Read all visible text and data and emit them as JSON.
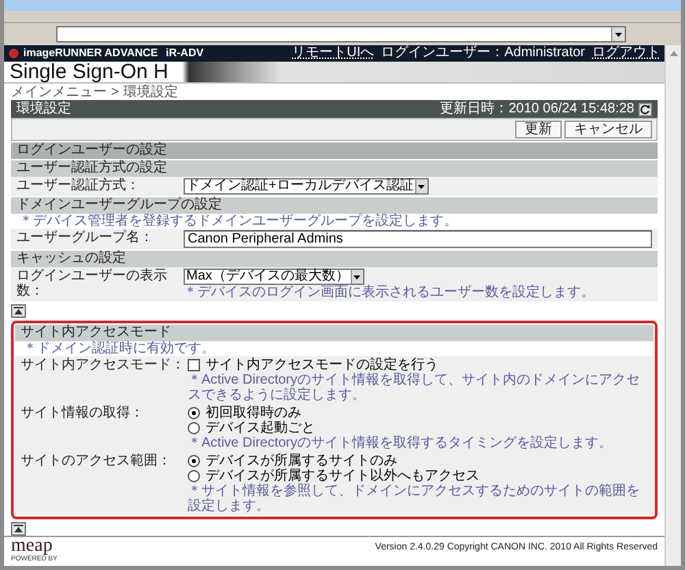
{
  "header": {
    "brand": "imageRUNNER ADVANCE",
    "device": "iR-ADV",
    "links": [
      {
        "kind": "link",
        "text": "リモートUIへ"
      },
      {
        "kind": "user",
        "text": "ログインユーザー：Administrator"
      },
      {
        "kind": "link",
        "text": "ログアウト"
      }
    ]
  },
  "title": "Single Sign-On H",
  "breadcrumb": {
    "items": [
      "メインメニュー",
      "環境設定"
    ],
    "separator": ">"
  },
  "panel": {
    "title": "環境設定",
    "updated": "更新日時：2010 06/24 15:48:28",
    "buttons": [
      "更新",
      "キャンセル"
    ],
    "blocks": [
      {
        "kind": "section",
        "label": "ログインユーザーの設定"
      },
      {
        "kind": "subsection",
        "label": "ユーザー認証方式の設定"
      },
      {
        "kind": "field",
        "label": "ユーザー認証方式：",
        "control": {
          "kind": "select",
          "value": "ドメイン認証+ローカルデバイス認証"
        }
      },
      {
        "kind": "subsection",
        "label": "ドメインユーザーグループの設定"
      },
      {
        "kind": "note",
        "text": "＊デバイス管理者を登録するドメインユーザーグループを設定します。"
      },
      {
        "kind": "field",
        "label": "ユーザーグループ名：",
        "control": {
          "kind": "text",
          "value": "Canon Peripheral Admins"
        }
      },
      {
        "kind": "subsection",
        "label": "キャッシュの設定"
      },
      {
        "kind": "field",
        "label": "ログインユーザーの表示数：",
        "control": {
          "kind": "select",
          "value": "Max（デバイスの最大数）"
        },
        "note": "＊デバイスのログイン画面に表示されるユーザー数を設定します。"
      },
      {
        "kind": "collapse"
      },
      {
        "kind": "highlight",
        "blocks": [
          {
            "kind": "subsection",
            "label": "サイト内アクセスモード"
          },
          {
            "kind": "note",
            "text": "＊ドメイン認証時に有効です。"
          },
          {
            "kind": "field",
            "label": "サイト内アクセスモード：",
            "control": {
              "kind": "checkbox",
              "label": "サイト内アクセスモードの設定を行う",
              "checked": false
            },
            "note": "＊Active Directoryのサイト情報を取得して、サイト内のドメインにアクセスできるように設定します。"
          },
          {
            "kind": "field",
            "label": "サイト情報の取得：",
            "control": {
              "kind": "radio",
              "options": [
                {
                  "label": "初回取得時のみ",
                  "selected": true
                },
                {
                  "label": "デバイス起動ごと",
                  "selected": false
                }
              ]
            },
            "note": "＊Active Directoryのサイト情報を取得するタイミングを設定します。"
          },
          {
            "kind": "field",
            "label": "サイトのアクセス範囲：",
            "control": {
              "kind": "radio",
              "options": [
                {
                  "label": "デバイスが所属するサイトのみ",
                  "selected": true
                },
                {
                  "label": "デバイスが所属するサイト以外へもアクセス",
                  "selected": false
                }
              ]
            },
            "note": "＊サイト情報を参照して、ドメインにアクセスするためのサイトの範囲を設定します。"
          }
        ]
      },
      {
        "kind": "collapse"
      }
    ]
  },
  "footer": {
    "logo": "meap",
    "logo_caption": "POWERED BY",
    "copyright": "Version 2.4.0.29 Copyright CANON INC. 2010 All Rights Reserved"
  }
}
